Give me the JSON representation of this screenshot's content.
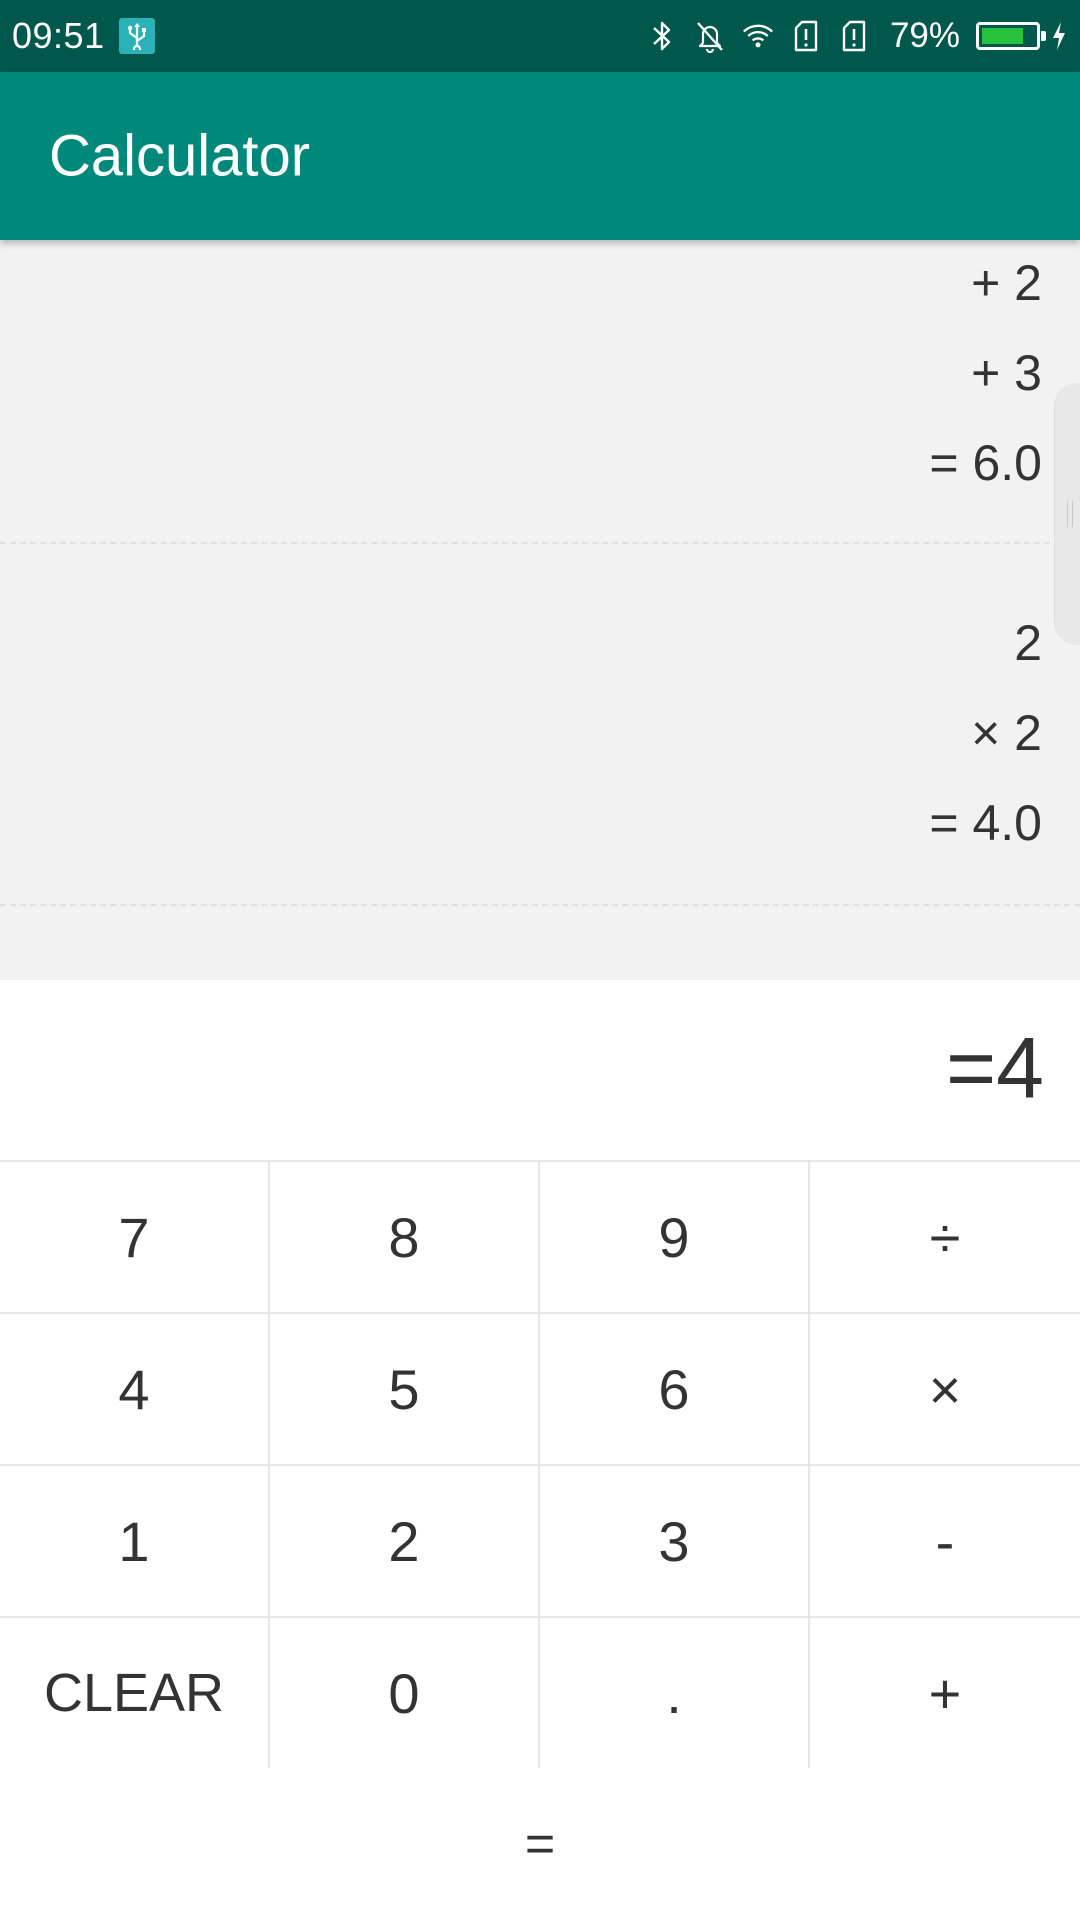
{
  "status_bar": {
    "time": "09:51",
    "battery_percent": "79%",
    "battery_level": 0.79,
    "icons": [
      "usb-icon",
      "bluetooth-icon",
      "notifications-off-icon",
      "wifi-icon",
      "sim-1-icon",
      "sim-2-icon",
      "battery-icon",
      "charging-icon"
    ]
  },
  "app_bar": {
    "title": "Calculator",
    "color": "#00897b"
  },
  "history": {
    "calc1": {
      "line1": "+ 2",
      "line2": "+ 3",
      "result": "= 6.0"
    },
    "calc2": {
      "line1": "2",
      "line2": "× 2",
      "result": "= 4.0"
    }
  },
  "display": {
    "value": "=4"
  },
  "keypad": {
    "k7": "7",
    "k8": "8",
    "k9": "9",
    "divide": "÷",
    "k4": "4",
    "k5": "5",
    "k6": "6",
    "multiply": "×",
    "k1": "1",
    "k2": "2",
    "k3": "3",
    "minus": "-",
    "clear": "CLEAR",
    "k0": "0",
    "decimal": ".",
    "plus": "+",
    "equals": "="
  }
}
